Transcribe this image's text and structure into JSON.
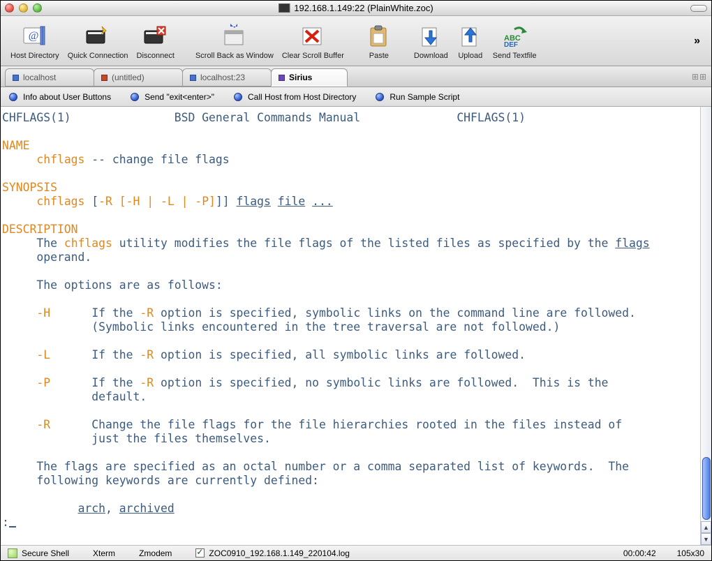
{
  "titlebar": {
    "title": "192.168.1.149:22 (PlainWhite.zoc)"
  },
  "toolbar": {
    "host_directory": "Host Directory",
    "quick_connection": "Quick Connection",
    "disconnect": "Disconnect",
    "scroll_back": "Scroll Back as Window",
    "clear_buffer": "Clear Scroll Buffer",
    "paste": "Paste",
    "download": "Download",
    "upload": "Upload",
    "send_textfile": "Send Textfile",
    "overflow": "»"
  },
  "tabs": [
    {
      "icon": "blue",
      "label": "localhost",
      "active": false
    },
    {
      "icon": "red",
      "label": "(untitled)",
      "active": false
    },
    {
      "icon": "blue",
      "label": "localhost:23",
      "active": false
    },
    {
      "icon": "purple",
      "label": "Sirius",
      "active": true
    }
  ],
  "userbuttons": [
    "Info about User Buttons",
    "Send \"exit<enter>\"",
    "Call Host from Host Directory",
    "Run Sample Script"
  ],
  "terminal": {
    "header_left": "CHFLAGS(1)",
    "header_center": "BSD General Commands Manual",
    "header_right": "CHFLAGS(1)",
    "name_heading": "NAME",
    "name_line": "     chflags -- change file flags",
    "name_cmd": "chflags",
    "name_rest": " -- change file flags",
    "synopsis_heading": "SYNOPSIS",
    "syn_cmd": "chflags",
    "syn_opts": "-R [-H | -L | -P]",
    "syn_flags": "flags",
    "syn_file": "file",
    "syn_dots": "...",
    "desc_heading": "DESCRIPTION",
    "desc_the": "The ",
    "desc_cmd": "chflags",
    "desc_rest1": " utility modifies the file flags of the listed files as specified by the ",
    "desc_flags": "flags",
    "desc_operand": "     operand.",
    "opts_intro": "     The options are as follows:",
    "opt_H": "-H",
    "opt_H_if": "If the ",
    "opt_R_flag": "-R",
    "opt_H_rest": " option is specified, symbolic links on the command line are followed.",
    "opt_H_line2": "             (Symbolic links encountered in the tree traversal are not followed.)",
    "opt_L": "-L",
    "opt_L_rest": " option is specified, all symbolic links are followed.",
    "opt_P": "-P",
    "opt_P_rest": " option is specified, no symbolic links are followed.  This is the",
    "opt_P_line2": "             default.",
    "opt_R": "-R",
    "opt_R_line1": "      Change the file flags for the file hierarchies rooted in the files instead of",
    "opt_R_line2": "             just the files themselves.",
    "flags_intro1": "     The flags are specified as an octal number or a comma separated list of keywords.  The",
    "flags_intro2": "     following keywords are currently defined:",
    "kw_arch": "arch",
    "kw_sep": ", ",
    "kw_archived": "archived",
    "prompt": ":"
  },
  "statusbar": {
    "shell": "Secure Shell",
    "term": "Xterm",
    "proto": "Zmodem",
    "log": "ZOC0910_192.168.1.149_220104.log",
    "time": "00:00:42",
    "size": "105x30"
  }
}
